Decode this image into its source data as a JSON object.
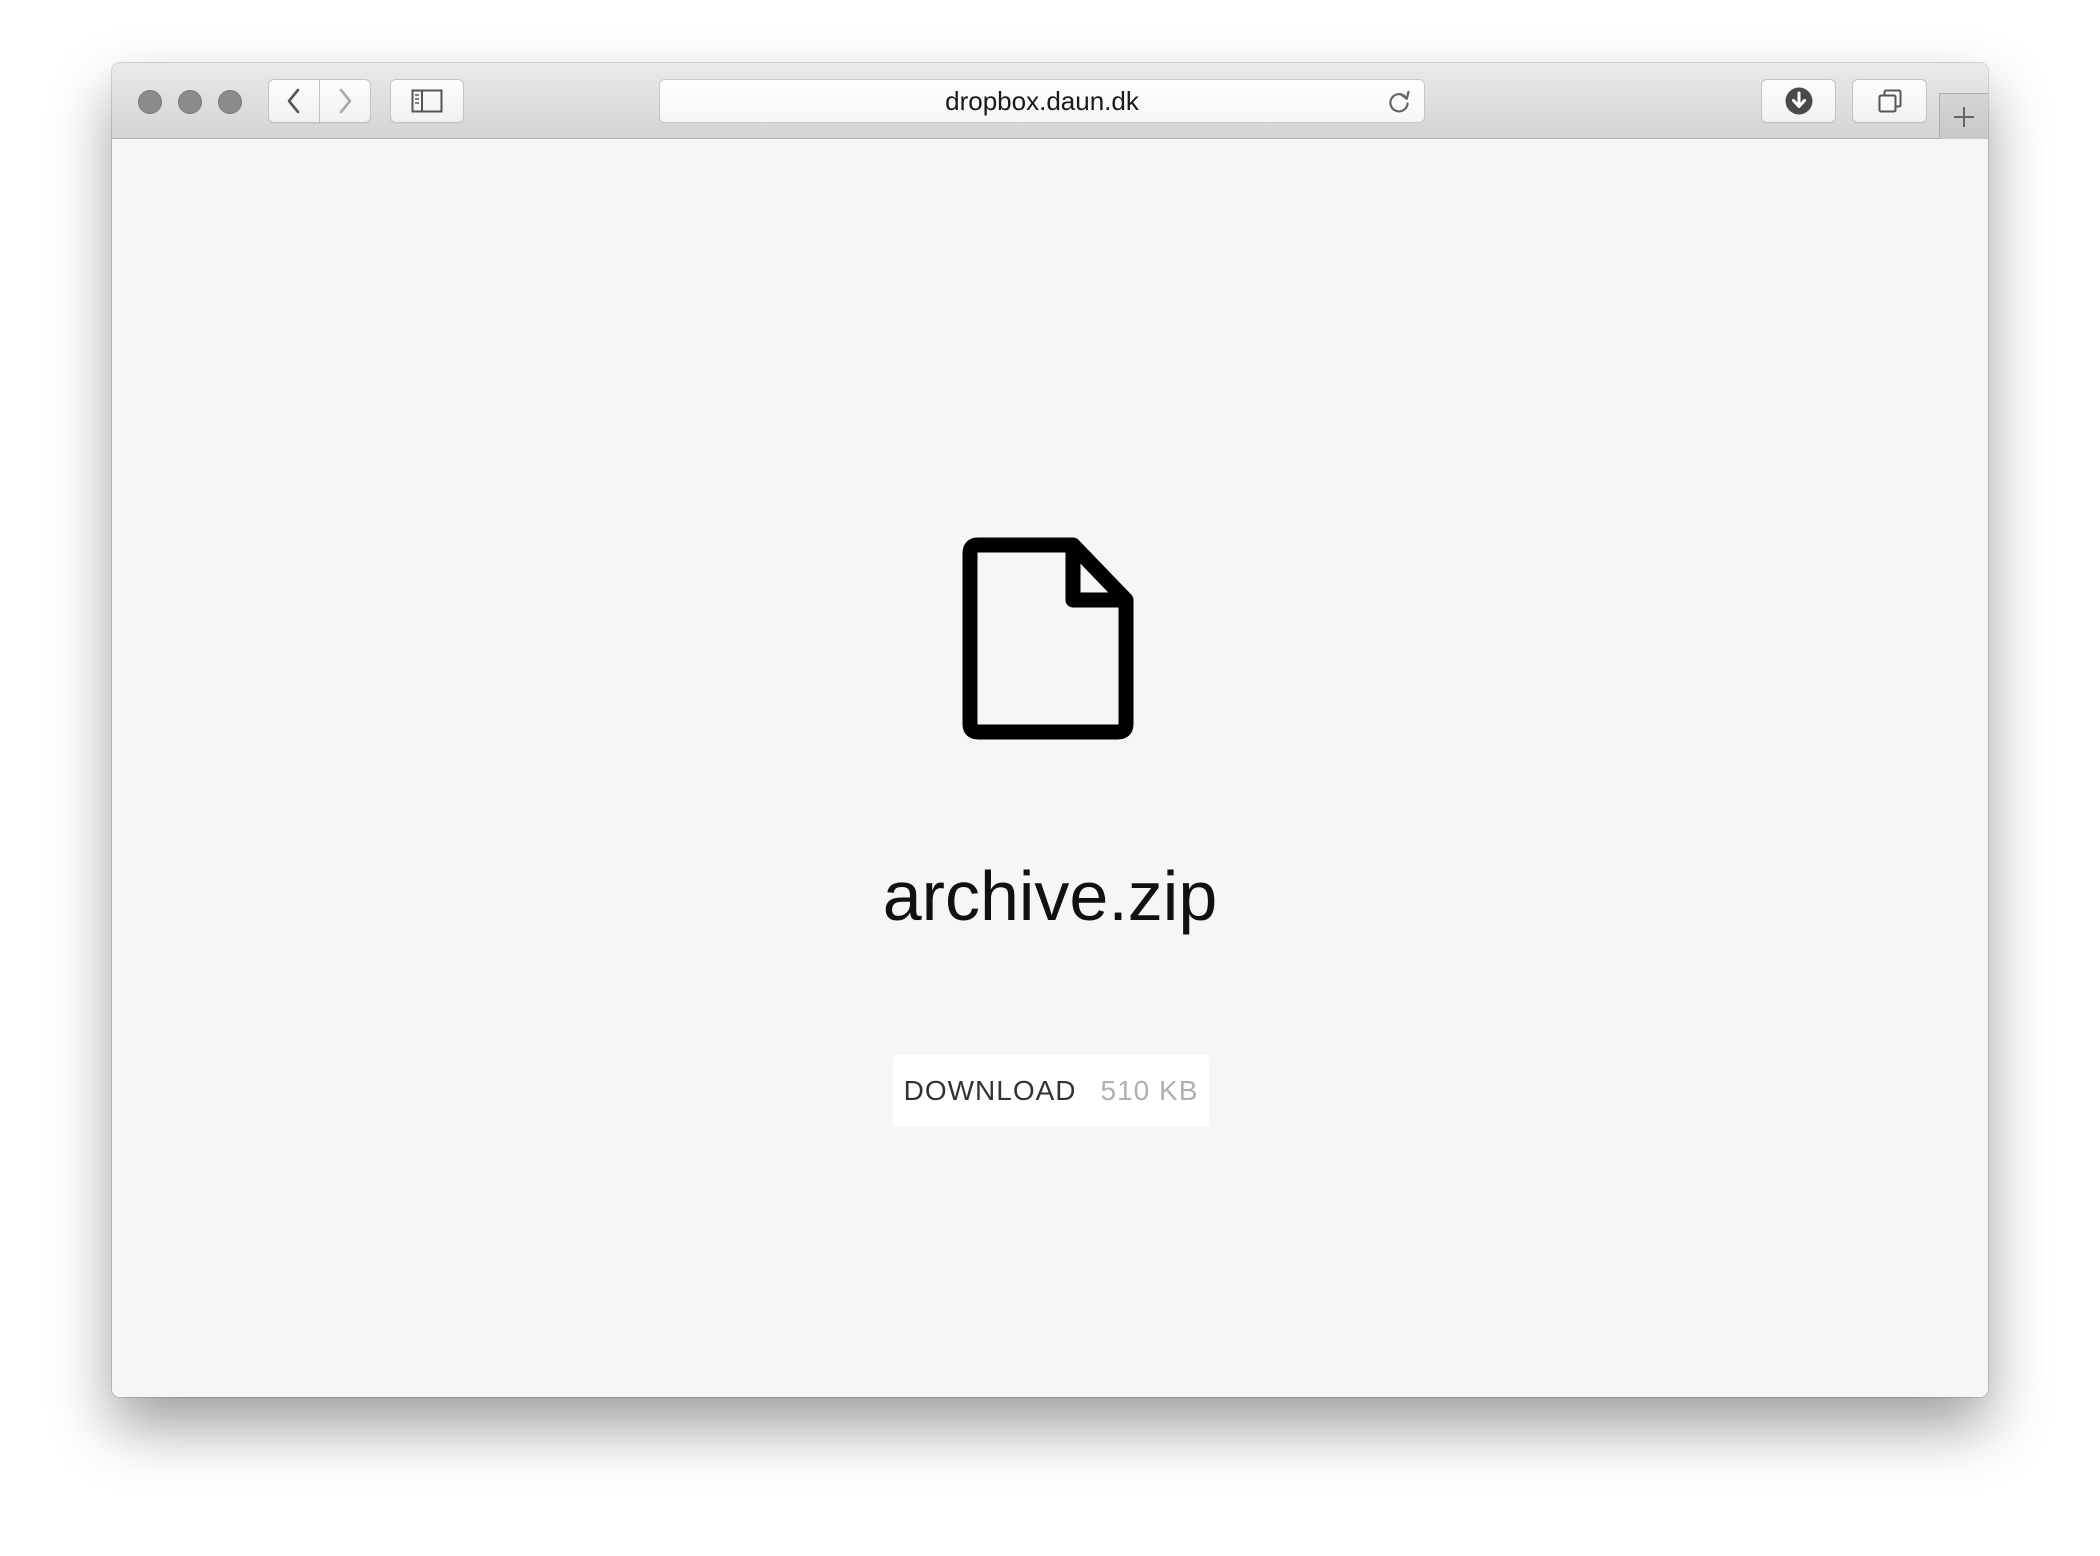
{
  "browser": {
    "address_bar": {
      "url": "dropbox.daun.dk"
    },
    "icons": {
      "back": "chevron-left-icon",
      "forward": "chevron-right-icon",
      "sidebar": "sidebar-icon",
      "reload": "reload-icon",
      "downloads": "download-circle-icon",
      "tabs": "tab-overview-icon",
      "new_tab": "plus-icon"
    }
  },
  "page": {
    "file_icon": "file-icon",
    "file_name": "archive.zip",
    "download": {
      "label": "DOWNLOAD",
      "size": "510 KB"
    }
  },
  "colors": {
    "page_background": "#f6f6f6",
    "button_background": "#ffffff",
    "text": "#111111",
    "muted_text": "#b0b0b0"
  }
}
